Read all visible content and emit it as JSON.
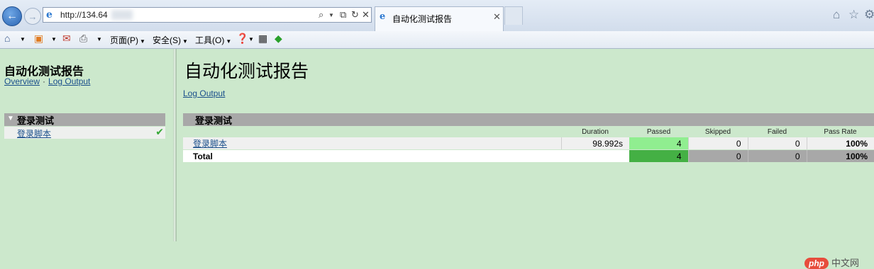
{
  "browser": {
    "url": "http://134.64",
    "tab_title": "自动化测试报告",
    "menu": {
      "page": "页面(P)",
      "safety": "安全(S)",
      "tools": "工具(O)"
    }
  },
  "sidebar": {
    "title": "自动化测试报告",
    "links": [
      "Overview",
      "Log Output"
    ],
    "suite": {
      "name": "登录测试",
      "tests": [
        {
          "name": "登录脚本",
          "status": "passed"
        }
      ]
    }
  },
  "main": {
    "title": "自动化测试报告",
    "log_link": "Log Output",
    "suite_name": "登录测试",
    "table": {
      "headers": [
        "",
        "Duration",
        "Passed",
        "Skipped",
        "Failed",
        "Pass Rate"
      ],
      "rows": [
        {
          "name": "登录脚本",
          "duration": "98.992s",
          "passed": "4",
          "skipped": "0",
          "failed": "0",
          "rate": "100%"
        }
      ],
      "total": {
        "name": "Total",
        "passed": "4",
        "skipped": "0",
        "failed": "0",
        "rate": "100%"
      }
    }
  },
  "watermark": {
    "badge": "php",
    "text": "中文网"
  },
  "colors": {
    "page_bg": "#cce8cc",
    "header_bar": "#a8a8a8",
    "passed_light": "#90ee90",
    "passed_dark": "#44b044"
  }
}
